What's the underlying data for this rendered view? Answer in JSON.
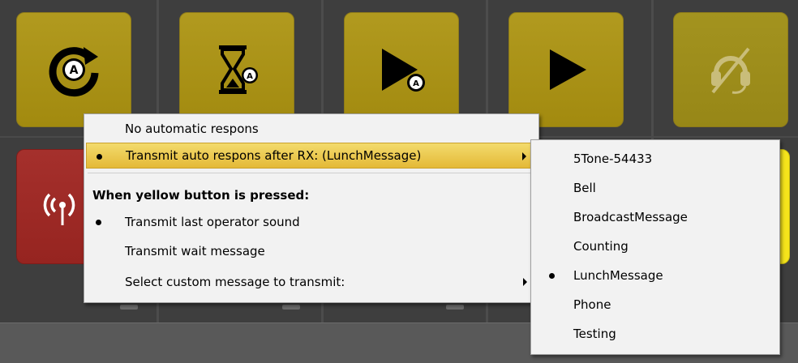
{
  "context_menu": {
    "items": [
      {
        "label": "No automatic respons",
        "selected": false,
        "has_submenu": false
      },
      {
        "label": "Transmit auto respons after RX: (LunchMessage)",
        "selected": true,
        "has_submenu": true,
        "highlighted": true
      }
    ],
    "section_heading": "When yellow button is pressed:",
    "section_items": [
      {
        "label": "Transmit last operator sound",
        "selected": true,
        "has_submenu": false
      },
      {
        "label": "Transmit wait message",
        "selected": false,
        "has_submenu": false
      },
      {
        "label": "Select custom message to transmit:",
        "selected": false,
        "has_submenu": true
      }
    ]
  },
  "submenu": {
    "items": [
      {
        "label": "5Tone-54433",
        "selected": false
      },
      {
        "label": "Bell",
        "selected": false
      },
      {
        "label": "BroadcastMessage",
        "selected": false
      },
      {
        "label": "Counting",
        "selected": false
      },
      {
        "label": "LunchMessage",
        "selected": true
      },
      {
        "label": "Phone",
        "selected": false
      },
      {
        "label": "Testing",
        "selected": false
      }
    ]
  },
  "tiles": [
    {
      "icon": "auto-repeat-icon",
      "color": "#b19a1f"
    },
    {
      "icon": "hourglass-auto-icon",
      "color": "#b19a1f"
    },
    {
      "icon": "play-auto-icon",
      "color": "#b19a1f"
    },
    {
      "icon": "play-icon",
      "color": "#b19a1f"
    },
    {
      "icon": "headset-muted-icon",
      "color": "#a3931f"
    },
    {
      "icon": "radio-antenna-icon",
      "color": "#a5302c"
    },
    {
      "icon": "yellow-button",
      "color": "#f5e41b"
    }
  ]
}
